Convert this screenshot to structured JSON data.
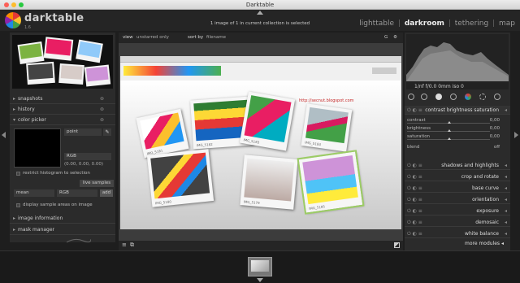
{
  "window": {
    "title": "Darktable"
  },
  "brand": {
    "name": "darktable",
    "version": "1.6"
  },
  "header": {
    "collection_info": "1 image of 1 in current collection is selected",
    "views": [
      "lighttable",
      "darkroom",
      "tethering",
      "map"
    ],
    "active_view": "darkroom",
    "view_sep": "|"
  },
  "left": {
    "sections": {
      "snapshots": "snapshots",
      "history": "history",
      "color_picker": "color picker",
      "image_information": "image information",
      "mask_manager": "mask manager"
    },
    "color_picker": {
      "mode": "point",
      "color_model": "RGB",
      "values": "(0.00, 0.00, 0.00)",
      "restrict_label": "restrict histogram to selection",
      "live_samples": "live samples",
      "stat": "mean",
      "stat_model": "RGB",
      "add_label": "add",
      "display_label": "display sample areas on image"
    }
  },
  "center": {
    "view_label": "view",
    "view_value": "unstarred only",
    "sort_label": "sort by",
    "sort_value": "filename",
    "right_label": "G",
    "image_url": "http://secnut.blogspot.com",
    "polaroid_captions": [
      "IMG_5181",
      "IMG_5182",
      "IMG_5183",
      "IMG_5184",
      "IMG_5180",
      "IMG_5179",
      "IMG_5185"
    ]
  },
  "right": {
    "histogram_info": "1/nf f/0.0 0mm iso 0",
    "expanded_module": {
      "name": "contrast brightness saturation",
      "sliders": [
        {
          "label": "contrast",
          "value": "0,00"
        },
        {
          "label": "brightness",
          "value": "0,00"
        },
        {
          "label": "saturation",
          "value": "0,00"
        }
      ],
      "blend_label": "blend",
      "blend_value": "off"
    },
    "modules": [
      "shadows and highlights",
      "crop and rotate",
      "base curve",
      "orientation",
      "exposure",
      "demosaic",
      "white balance"
    ],
    "more_modules": "more modules"
  },
  "colors": {
    "accent": "#9ccc65",
    "bg": "#2b2b2b"
  }
}
